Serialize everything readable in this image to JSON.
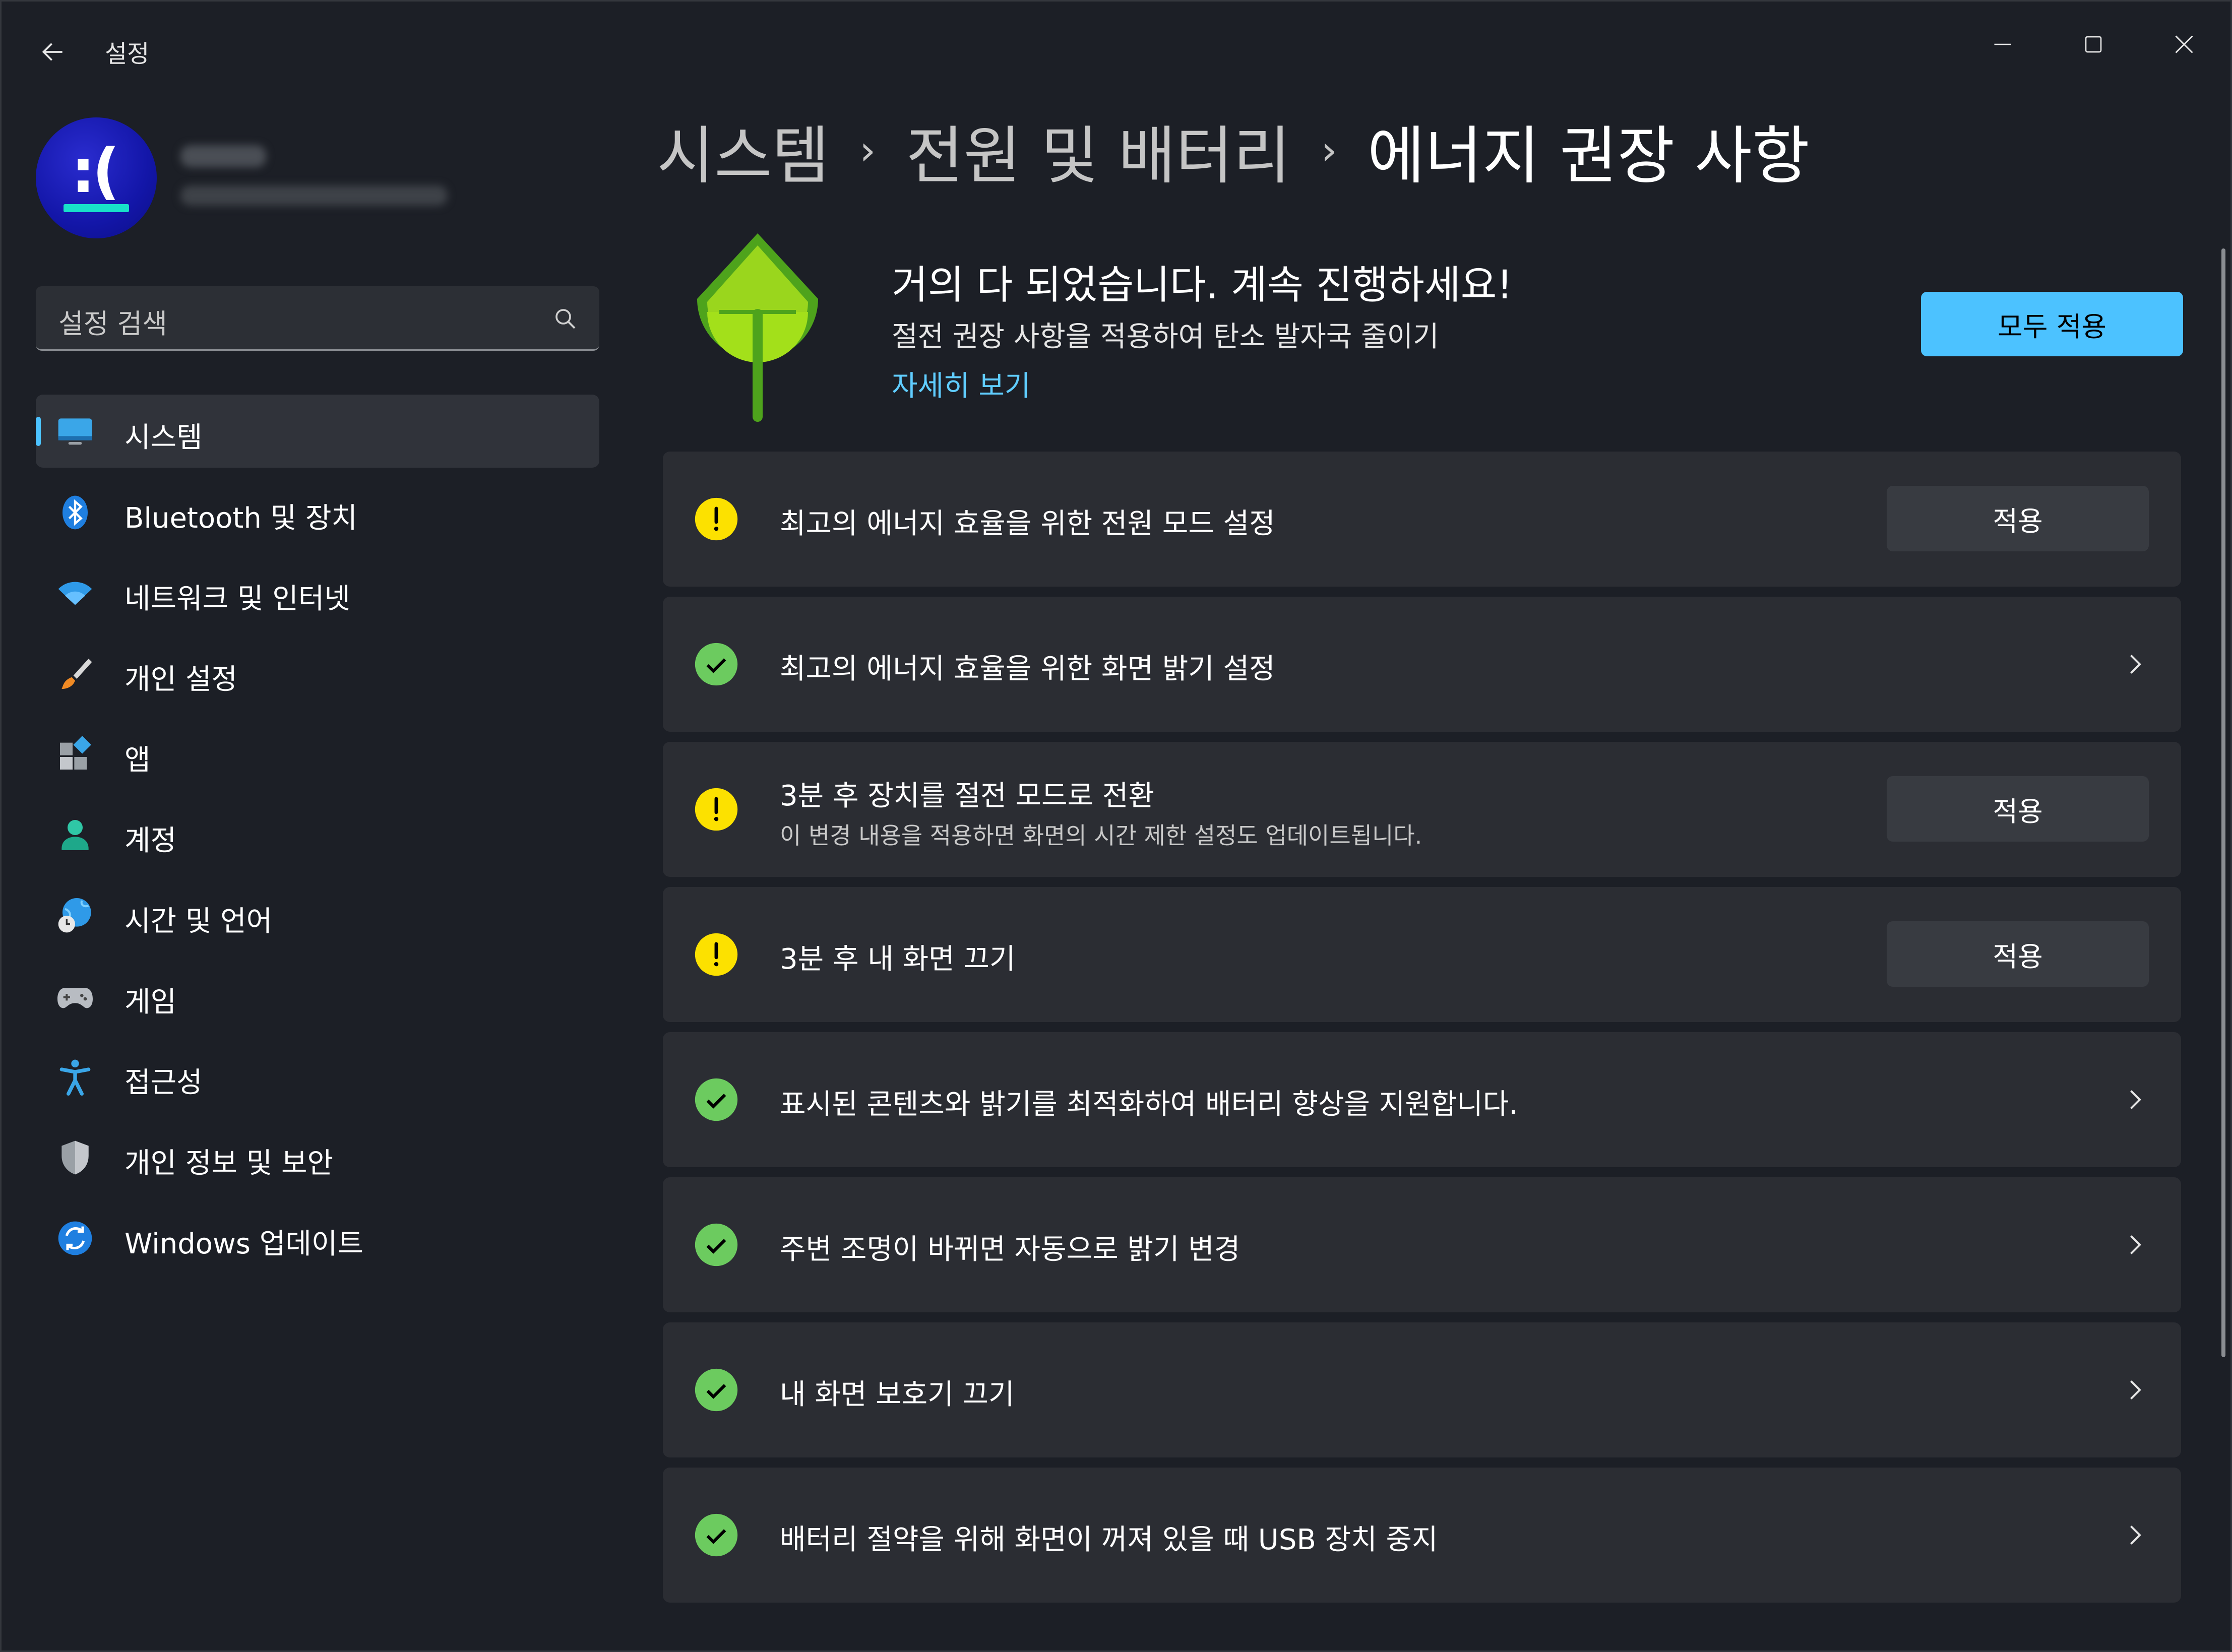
{
  "window": {
    "app_title": "설정",
    "controls": [
      "minimize",
      "maximize",
      "close"
    ]
  },
  "search": {
    "placeholder": "설정 검색"
  },
  "sidebar": {
    "items": [
      {
        "label": "시스템",
        "icon": "system-icon",
        "active": true
      },
      {
        "label": "Bluetooth 및 장치",
        "icon": "bluetooth-icon"
      },
      {
        "label": "네트워크 및 인터넷",
        "icon": "wifi-icon"
      },
      {
        "label": "개인 설정",
        "icon": "brush-icon"
      },
      {
        "label": "앱",
        "icon": "apps-icon"
      },
      {
        "label": "계정",
        "icon": "person-icon"
      },
      {
        "label": "시간 및 언어",
        "icon": "globe-clock-icon"
      },
      {
        "label": "게임",
        "icon": "gamepad-icon"
      },
      {
        "label": "접근성",
        "icon": "accessibility-icon"
      },
      {
        "label": "개인 정보 및 보안",
        "icon": "shield-icon"
      },
      {
        "label": "Windows 업데이트",
        "icon": "update-icon"
      }
    ]
  },
  "breadcrumb": [
    "시스템",
    "전원 및 배터리",
    "에너지 권장 사항"
  ],
  "hero": {
    "title": "거의 다 되었습니다. 계속 진행하세요!",
    "subtitle": "절전 권장 사항을 적용하여 탄소 발자국 줄이기",
    "link": "자세히 보기",
    "apply_all": "모두 적용"
  },
  "recommendations": [
    {
      "status": "warning",
      "title": "최고의 에너지 효율을 위한 전원 모드 설정",
      "action": "적용"
    },
    {
      "status": "done",
      "title": "최고의 에너지 효율을 위한 화면 밝기 설정"
    },
    {
      "status": "warning",
      "title": "3분 후 장치를 절전 모드로 전환",
      "description": "이 변경 내용을 적용하면 화면의 시간 제한 설정도 업데이트됩니다.",
      "action": "적용"
    },
    {
      "status": "warning",
      "title": "3분 후 내 화면 끄기",
      "action": "적용"
    },
    {
      "status": "done",
      "title": "표시된 콘텐츠와 밝기를 최적화하여 배터리 향상을 지원합니다."
    },
    {
      "status": "done",
      "title": "주변 조명이 바뀌면 자동으로 밝기 변경"
    },
    {
      "status": "done",
      "title": "내 화면 보호기 끄기"
    },
    {
      "status": "done",
      "title": "배터리 절약을 위해 화면이 꺼져 있을 때 USB 장치 중지"
    }
  ],
  "colors": {
    "accent": "#4cc2ff",
    "warning": "#fce100",
    "success": "#6ccb5f",
    "background": "#1c1f26",
    "card": "#2b2d33"
  }
}
